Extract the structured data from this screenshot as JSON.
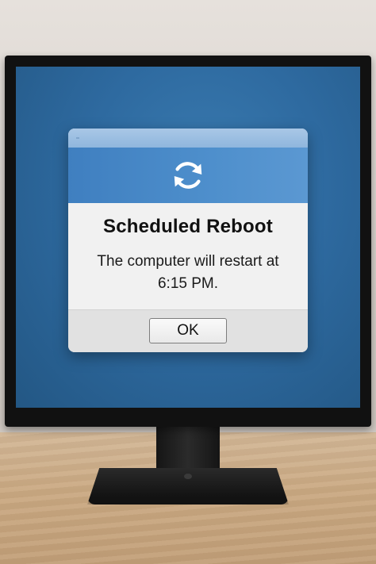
{
  "dialog": {
    "title": "Scheduled Reboot",
    "message": "The computer will restart at 6:15 PM.",
    "icon": "refresh-icon",
    "ok_label": "OK"
  },
  "colors": {
    "desktop": "#2e6aa0",
    "dialog_header": "#4e8fcc",
    "titlebar": "#a9c7e6"
  }
}
